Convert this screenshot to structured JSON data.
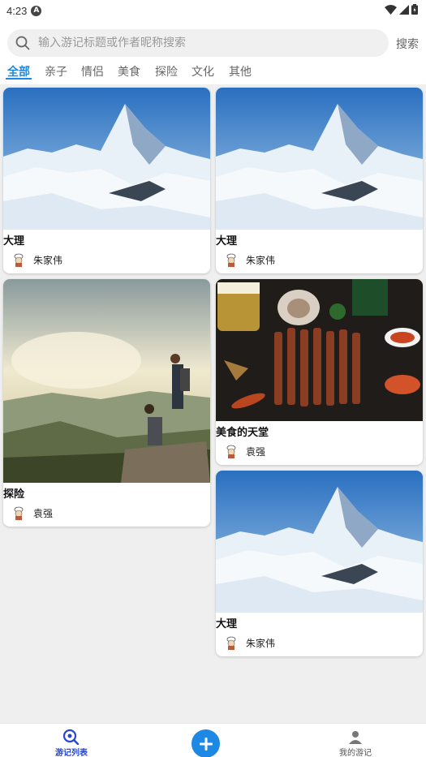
{
  "status_bar": {
    "time": "4:23",
    "indicator": "A"
  },
  "search": {
    "placeholder": "输入游记标题或作者昵称搜索",
    "value": "",
    "button_label": "搜索"
  },
  "tabs": [
    {
      "label": "全部",
      "active": true
    },
    {
      "label": "亲子",
      "active": false
    },
    {
      "label": "情侣",
      "active": false
    },
    {
      "label": "美食",
      "active": false
    },
    {
      "label": "探险",
      "active": false
    },
    {
      "label": "文化",
      "active": false
    },
    {
      "label": "其他",
      "active": false
    }
  ],
  "cards": [
    {
      "title": "大理",
      "author": "朱家伟",
      "image": "snow-mountain"
    },
    {
      "title": "大理",
      "author": "朱家伟",
      "image": "snow-mountain"
    },
    {
      "title": "探险",
      "author": "袁强",
      "image": "hikers-cliff"
    },
    {
      "title": "美食的天堂",
      "author": "袁强",
      "image": "bbq-skewers"
    },
    {
      "title": "大理",
      "author": "朱家伟",
      "image": "snow-mountain"
    }
  ],
  "bottom_nav": {
    "list_label": "游记列表",
    "mine_label": "我的游记",
    "icons": {
      "list": "travel-list-search-icon",
      "add": "add-icon",
      "mine": "person-icon"
    }
  },
  "colors": {
    "accent": "#1e88e5",
    "nav_active": "#2747d4",
    "background": "#efefef"
  }
}
